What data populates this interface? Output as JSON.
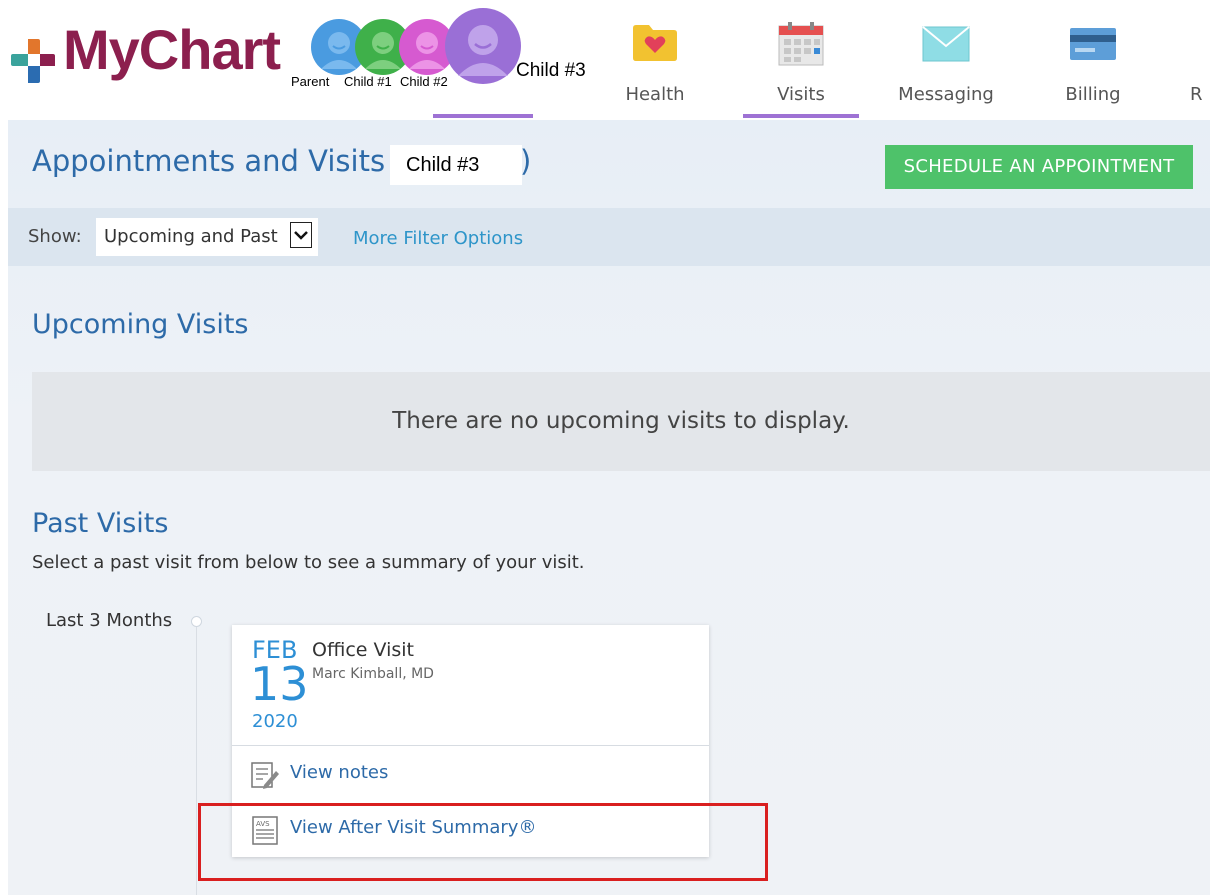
{
  "header": {
    "logo_text": "MyChart",
    "proxies": [
      {
        "label": "Parent",
        "color": "#4a9be0"
      },
      {
        "label": "Child #1",
        "color": "#3fb04a"
      },
      {
        "label": "Child #2",
        "color": "#d65ad0"
      },
      {
        "label": "Child #3",
        "color": "#9a6fd6"
      }
    ],
    "nav": [
      {
        "label": "Health",
        "icon": "folder-heart-icon"
      },
      {
        "label": "Visits",
        "icon": "calendar-icon"
      },
      {
        "label": "Messaging",
        "icon": "envelope-icon"
      },
      {
        "label": "Billing",
        "icon": "credit-card-icon"
      },
      {
        "label": "R",
        "icon": ""
      }
    ],
    "active_nav": "Visits"
  },
  "page": {
    "title_prefix": "Appointments and Visits (",
    "title_child": "Child #3",
    "title_suffix": ")",
    "schedule_button": "SCHEDULE AN APPOINTMENT"
  },
  "filter": {
    "show_label": "Show:",
    "selected": "Upcoming and Past",
    "more_filters": "More Filter Options"
  },
  "upcoming": {
    "title": "Upcoming Visits",
    "empty_message": "There are no upcoming visits to display."
  },
  "past": {
    "title": "Past Visits",
    "subtitle": "Select a past visit from below to see a summary of your visit.",
    "group_label": "Last 3 Months",
    "visit": {
      "month": "FEB",
      "day": "13",
      "year": "2020",
      "type": "Office Visit",
      "provider": "Marc Kimball, MD",
      "actions": [
        {
          "label": "View notes",
          "icon": "notes-pencil-icon"
        },
        {
          "label": "View After Visit Summary®",
          "icon": "avs-document-icon"
        }
      ]
    }
  },
  "colors": {
    "brand_maroon": "#8c1f4e",
    "title_blue": "#2d6aa8",
    "link_blue": "#2e95c9",
    "schedule_green": "#4ec26a",
    "nav_active": "#9e72d4",
    "highlight_red": "#d91f1f"
  }
}
